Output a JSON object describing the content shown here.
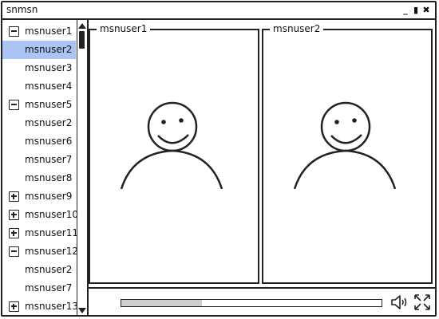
{
  "window": {
    "title": "snmsn",
    "controls": [
      {
        "name": "minimize",
        "glyph": "_"
      },
      {
        "name": "maximize",
        "glyph": "▮"
      },
      {
        "name": "close",
        "glyph": "✖"
      }
    ]
  },
  "tree": {
    "rows": [
      {
        "label": "msnuser1",
        "kind": "parent",
        "toggle": "collapse",
        "selected": false
      },
      {
        "label": "msnuser2",
        "kind": "child",
        "selected": true
      },
      {
        "label": "msnuser3",
        "kind": "child",
        "selected": false
      },
      {
        "label": "msnuser4",
        "kind": "child",
        "selected": false
      },
      {
        "label": "msnuser5",
        "kind": "parent",
        "toggle": "collapse",
        "selected": false
      },
      {
        "label": "msnuser2",
        "kind": "child",
        "selected": false
      },
      {
        "label": "msnuser6",
        "kind": "child",
        "selected": false
      },
      {
        "label": "msnuser7",
        "kind": "child",
        "selected": false
      },
      {
        "label": "msnuser8",
        "kind": "child",
        "selected": false
      },
      {
        "label": "msnuser9",
        "kind": "parent",
        "toggle": "expand",
        "selected": false
      },
      {
        "label": "msnuser10",
        "kind": "parent",
        "toggle": "expand",
        "selected": false
      },
      {
        "label": "msnuser11",
        "kind": "parent",
        "toggle": "expand",
        "selected": false
      },
      {
        "label": "msnuser12",
        "kind": "parent",
        "toggle": "collapse",
        "selected": false
      },
      {
        "label": "msnuser2",
        "kind": "child",
        "selected": false
      },
      {
        "label": "msnuser7",
        "kind": "child",
        "selected": false
      },
      {
        "label": "msnuser13",
        "kind": "parent",
        "toggle": "expand",
        "selected": false
      }
    ]
  },
  "video": {
    "panels": [
      {
        "label": "msnuser1",
        "icon": "user-avatar-icon"
      },
      {
        "label": "msnuser2",
        "icon": "user-avatar-icon"
      }
    ]
  },
  "player": {
    "progress": 0.31,
    "icons": [
      "speaker-icon",
      "fullscreen-icon"
    ]
  },
  "colors": {
    "selected_row": "#a9c4f5",
    "ink": "#222222",
    "progress_fill": "#cfcfcf"
  }
}
